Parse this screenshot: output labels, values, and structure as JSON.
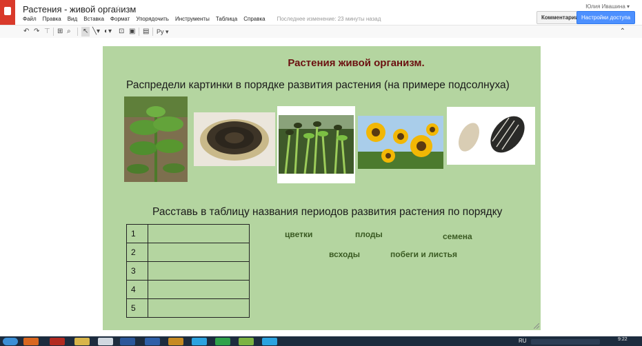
{
  "app": {
    "doc_title": "Растения - живой организм",
    "user": "Юлия Ивашина ▾",
    "menu": [
      "Файл",
      "Правка",
      "Вид",
      "Вставка",
      "Формат",
      "Упорядочить",
      "Инструменты",
      "Таблица",
      "Справка"
    ],
    "last_edit": "Последнее изменение: 23 минуты назад",
    "comments_label": "Комментарии",
    "share_label": "Настройки доступа",
    "toolbar_lang": "Ру",
    "toolbar_icons": [
      "undo-icon",
      "redo-icon",
      "paint-format-icon",
      "zoom-fit-icon",
      "zoom-icon",
      "select-icon",
      "line-icon",
      "shape-icon",
      "textbox-icon",
      "image-icon",
      "comment-icon",
      "collapse-icon"
    ]
  },
  "slide": {
    "title": "Растения живой организм.",
    "instruction_pictures": "Распредели картинки в порядке развития растения (на примере подсолнуха)",
    "instruction_table": "Расставь в таблицу названия периодов развития растения по порядку",
    "pictures": [
      "young-sunflower-plant-image",
      "sunflower-seed-head-image",
      "sprouts-image",
      "sunflower-flowers-image",
      "sunflower-seeds-image"
    ],
    "table_rows": [
      "1",
      "2",
      "3",
      "4",
      "5"
    ],
    "words": {
      "flowers": "цветки",
      "fruits": "плоды",
      "seeds": "семена",
      "sprouts": "всходы",
      "shoots_leaves": "побеги и листья"
    }
  },
  "taskbar": {
    "lang": "RU",
    "clock": "9:22"
  },
  "colors": {
    "slide_bg": "#b4d5a0",
    "title_color": "#6b1010",
    "word_color": "#3a5a22",
    "share_button": "#4d90fe",
    "logo": "#d93a2b"
  }
}
